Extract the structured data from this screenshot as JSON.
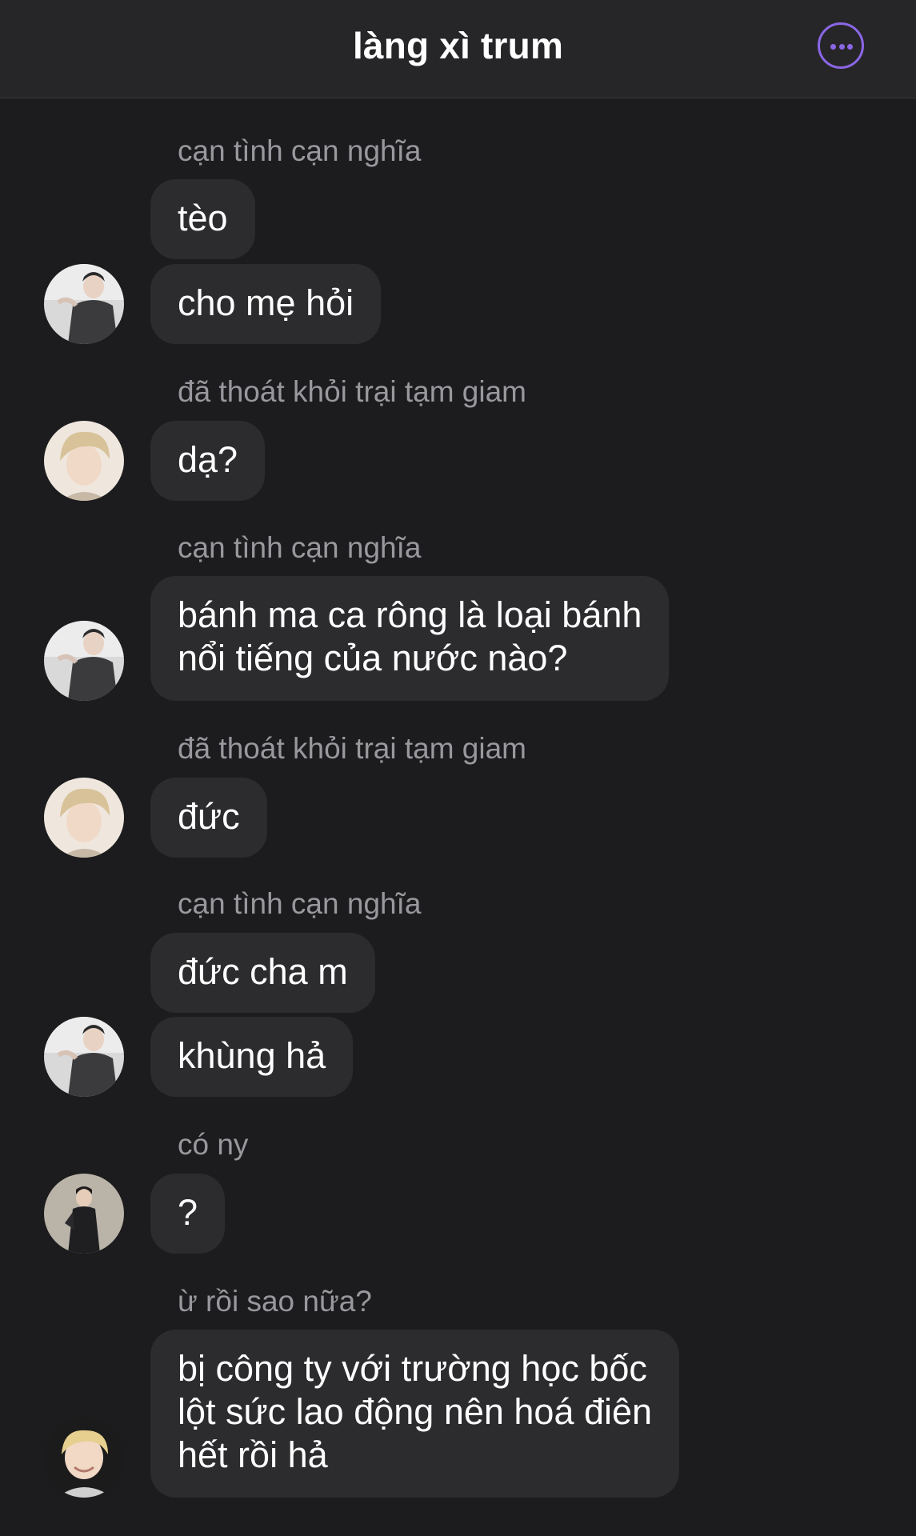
{
  "header": {
    "title": "làng xì trum",
    "more_icon": "ellipsis-circle-icon",
    "accent": "#8b67e6"
  },
  "messages": [
    {
      "sender": "cạn tình cạn nghĩa",
      "bubbles": [
        "tèo",
        "cho mẹ hỏi"
      ],
      "avatar": "avatar-white-hair-shirt"
    },
    {
      "sender": "đã thoát khỏi trại tạm giam",
      "bubbles": [
        "dạ?"
      ],
      "avatar": "avatar-blonde"
    },
    {
      "sender": "cạn tình cạn nghĩa",
      "bubbles": [
        "bánh ma ca rông là loại bánh",
        "nổi tiếng của nước nào?"
      ],
      "avatar": "avatar-white-hair-shirt"
    },
    {
      "sender": "đã thoát khỏi trại tạm giam",
      "bubbles": [
        "đức"
      ],
      "avatar": "avatar-blonde"
    },
    {
      "sender": "cạn tình cạn nghĩa",
      "bubbles": [
        "đức cha m",
        "khùng hả"
      ],
      "avatar": "avatar-white-hair-shirt"
    },
    {
      "sender": "có ny",
      "bubbles": [
        "?"
      ],
      "avatar": "avatar-dark-suit"
    },
    {
      "sender": "ừ rồi sao nữa?",
      "bubbles": [
        "bị công ty với trường học bốc",
        "lột sức lao động nên hoá điên",
        "hết rồi hả"
      ],
      "avatar": "avatar-smiling-blonde"
    }
  ],
  "colors": {
    "background": "#1c1c1e",
    "bubble": "#2c2c2e",
    "sender_text": "#98989d"
  }
}
